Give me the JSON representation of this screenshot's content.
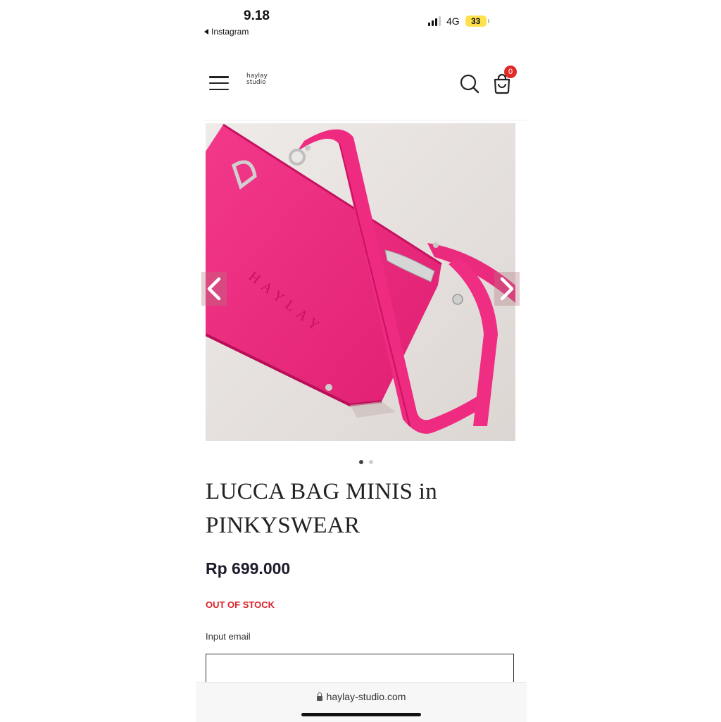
{
  "status_bar": {
    "time": "9.18",
    "back_app": "Instagram",
    "network": "4G",
    "battery": "33"
  },
  "header": {
    "logo_line1": "haylay",
    "logo_line2": "studio",
    "cart_count": "0"
  },
  "product": {
    "title": "LUCCA BAG MINIS in PINKYSWEAR",
    "price": "Rp 699.000",
    "stock_status": "OUT OF STOCK",
    "image_embossed_text": "HAYLAY",
    "carousel_total": 2,
    "carousel_active": 1
  },
  "form": {
    "email_label": "Input email",
    "email_value": ""
  },
  "browser": {
    "url": "haylay-studio.com"
  },
  "colors": {
    "bag_pink": "#f0287f",
    "stock_red": "#d8232a",
    "badge_red": "#e02a2a"
  }
}
